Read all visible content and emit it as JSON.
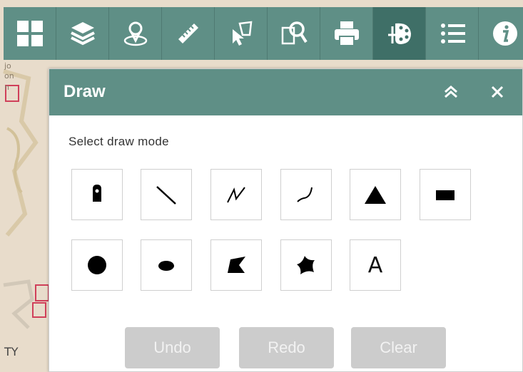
{
  "map": {
    "labels": [
      "jo",
      "on",
      "n",
      "TY"
    ]
  },
  "toolbar": {
    "tools": [
      {
        "name": "basemap-gallery",
        "icon": "grid-icon"
      },
      {
        "name": "layer-list",
        "icon": "layers-icon"
      },
      {
        "name": "locate",
        "icon": "locate-pin-icon"
      },
      {
        "name": "measurement",
        "icon": "ruler-icon"
      },
      {
        "name": "select",
        "icon": "select-cursor-icon"
      },
      {
        "name": "query",
        "icon": "query-magnifier-icon"
      },
      {
        "name": "print",
        "icon": "printer-icon"
      },
      {
        "name": "draw",
        "icon": "palette-icon",
        "active": true
      },
      {
        "name": "legend",
        "icon": "list-icon"
      },
      {
        "name": "about",
        "icon": "info-icon"
      }
    ]
  },
  "panel": {
    "title": "Draw",
    "prompt": "Select draw mode",
    "modes": [
      {
        "name": "point",
        "icon": "map-pin-icon"
      },
      {
        "name": "line",
        "icon": "line-icon"
      },
      {
        "name": "polyline",
        "icon": "polyline-icon"
      },
      {
        "name": "freehand-polyline",
        "icon": "freehand-line-icon"
      },
      {
        "name": "triangle",
        "icon": "triangle-icon"
      },
      {
        "name": "rectangle",
        "icon": "rectangle-icon"
      },
      {
        "name": "circle",
        "icon": "circle-icon"
      },
      {
        "name": "ellipse",
        "icon": "ellipse-icon"
      },
      {
        "name": "polygon",
        "icon": "polygon-icon"
      },
      {
        "name": "freehand-polygon",
        "icon": "freehand-polygon-icon"
      },
      {
        "name": "text",
        "icon": "text-icon",
        "label": "A"
      }
    ],
    "buttons": {
      "undo": "Undo",
      "redo": "Redo",
      "clear": "Clear"
    }
  },
  "colors": {
    "header": "#5f8f86",
    "active_tool": "#3f6f67",
    "disabled_button": "#cccccc"
  }
}
